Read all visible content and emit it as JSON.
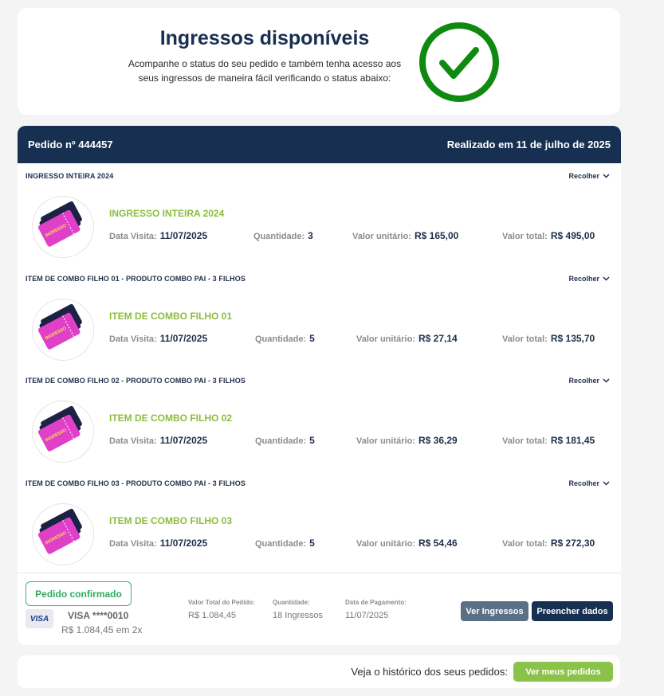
{
  "status": {
    "title": "Ingressos disponíveis",
    "subtitle_line1": "Acompanhe o status do seu pedido e também tenha acesso aos",
    "subtitle_line2": "seus ingressos de maneira fácil verificando o status abaixo:",
    "check_color": "#0f8a11"
  },
  "order": {
    "number_label": "Pedido nº 444457",
    "date_label": "Realizado em 11 de julho de 2025",
    "collapse_label": "Recolher",
    "field_labels": {
      "visit": "Data Visita:",
      "quantity": "Quantidade:",
      "unit_price": "Valor unitário:",
      "total": "Valor total:"
    },
    "ticket_label": "INGRESSO",
    "items": [
      {
        "group": "INGRESSO INTEIRA 2024",
        "name": "INGRESSO INTEIRA 2024",
        "visit_date": "11/07/2025",
        "quantity": "3",
        "unit_price": "R$ 165,00",
        "total": "R$ 495,00"
      },
      {
        "group": "ITEM DE COMBO FILHO 01 - PRODUTO COMBO PAI - 3 FILHOS",
        "name": "ITEM DE COMBO FILHO 01",
        "visit_date": "11/07/2025",
        "quantity": "5",
        "unit_price": "R$ 27,14",
        "total": "R$ 135,70"
      },
      {
        "group": "ITEM DE COMBO FILHO 02 - PRODUTO COMBO PAI - 3 FILHOS",
        "name": "ITEM DE COMBO FILHO 02",
        "visit_date": "11/07/2025",
        "quantity": "5",
        "unit_price": "R$ 36,29",
        "total": "R$ 181,45"
      },
      {
        "group": "ITEM DE COMBO FILHO 03 - PRODUTO COMBO PAI - 3 FILHOS",
        "name": "ITEM DE COMBO FILHO 03",
        "visit_date": "11/07/2025",
        "quantity": "5",
        "unit_price": "R$ 54,46",
        "total": "R$ 272,30"
      }
    ],
    "footer": {
      "confirmed_label": "Pedido confirmado",
      "card_brand": "VISA",
      "card_number": "VISA ****0010",
      "installments": "R$ 1.084,45 em 2x",
      "total_label": "Valor Total do Pedido:",
      "total_value": "R$ 1.084,45",
      "quantity_label": "Quantidade:",
      "quantity_value": "18 Ingressos",
      "payment_date_label": "Data de Pagamento:",
      "payment_date_value": "11/07/2025",
      "view_tickets_label": "Ver Ingressos",
      "fill_data_label": "Preencher dados"
    }
  },
  "history": {
    "text": "Veja o histórico dos seus pedidos:",
    "button_label": "Ver meus pedidos"
  },
  "colors": {
    "navy": "#172f50",
    "accent_green": "#8bbd3c",
    "ticket_pink": "#e040c8"
  }
}
